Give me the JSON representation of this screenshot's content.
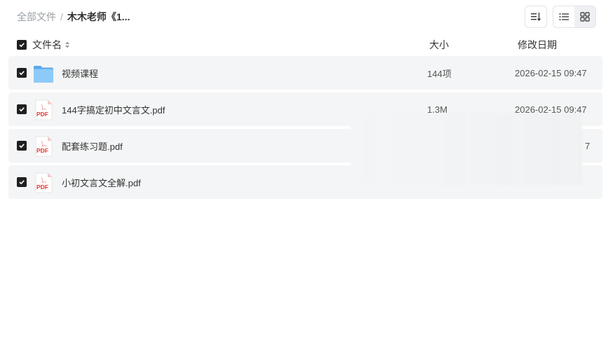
{
  "breadcrumb": {
    "root": "全部文件",
    "separator": "/",
    "current": "木木老师《1..."
  },
  "toolbar": {
    "sort_icon": "sort-lines-icon",
    "list_view_icon": "list-view-icon",
    "grid_view_icon": "grid-view-icon",
    "active_view": "list"
  },
  "columns": {
    "name": "文件名",
    "size": "大小",
    "date": "修改日期"
  },
  "files": [
    {
      "name": "视频课程",
      "type": "folder",
      "size": "144项",
      "date": "2026-02-15 09:47"
    },
    {
      "name": "144字搞定初中文言文.pdf",
      "type": "pdf",
      "size": "1.3M",
      "date": "2026-02-15 09:47"
    },
    {
      "name": "配套练习题.pdf",
      "type": "pdf",
      "size": "",
      "date": "7"
    },
    {
      "name": "小初文言文全解.pdf",
      "type": "pdf",
      "size": "",
      "date": ""
    }
  ],
  "pdf_label": "PDF",
  "colors": {
    "row_bg": "#f4f5f6",
    "checkbox": "#1f1f1f",
    "pdf_red": "#e53935",
    "folder_blue": "#6fb6f2"
  }
}
